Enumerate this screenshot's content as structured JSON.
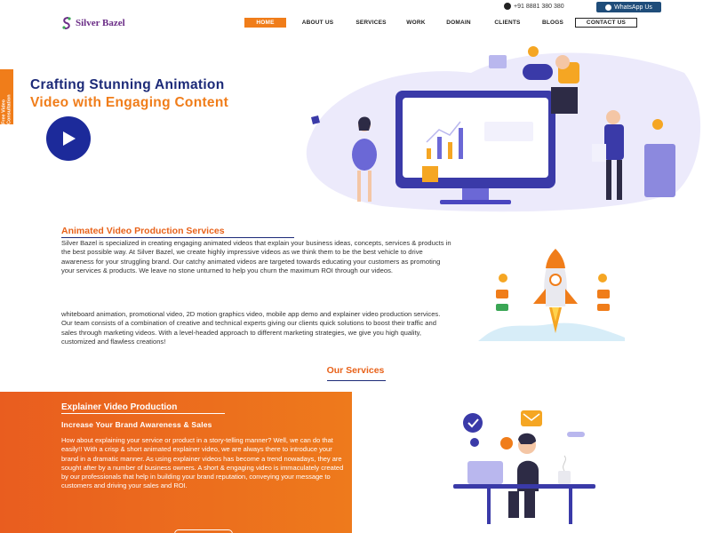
{
  "topbar": {
    "phone": "+91 8881 380 380",
    "whatsapp_label": "WhatsApp Us"
  },
  "header": {
    "logo_text": "Silver Bazel",
    "nav": [
      "HOME",
      "ABOUT US",
      "SERVICES",
      "WORK",
      "DOMAIN",
      "CLIENTS",
      "BLOGS",
      "CONTACT US"
    ]
  },
  "side_tab": {
    "label": "Free Video Consultation"
  },
  "hero": {
    "title_line1": "Crafting Stunning Animation",
    "title_line2": "Video with Engaging Content"
  },
  "about": {
    "title": "Animated Video Production Services",
    "para1": "Silver Bazel is specialized in creating engaging animated videos that explain your business ideas, concepts, services & products in the best possible way. At Silver Bazel, we create highly impressive videos as we think them to be the best vehicle to drive awareness for your struggling brand. Our catchy animated videos are targeted towards educating your customers as promoting your services & products. We leave no stone unturned to help you churn the maximum ROI through our videos.",
    "para2": "whiteboard animation, promotional video, 2D motion graphics video, mobile app demo and explainer video production services. Our team consists of a combination of creative and technical experts giving our clients quick solutions to boost their traffic and sales through marketing videos. With a level-headed approach to different marketing strategies, we give you high quality, customized and flawless creations!"
  },
  "services": {
    "heading": "Our Services",
    "card": {
      "title": "Explainer Video Production",
      "subtitle": "Increase Your Brand Awareness & Sales",
      "text": "How about explaining your service or product in a story-telling manner? Well, we can do that easily!! With a crisp & short animated explainer video, we are always there to introduce your brand in a dramatic manner. As using explainer videos has become a trend nowadays, they are sought after by a number of business owners. A short & engaging video is immaculately created by our professionals that help in building your brand reputation, conveying your message to customers and driving your sales and ROI."
    }
  },
  "colors": {
    "brand_orange": "#f07d1a",
    "brand_navy": "#1c2a78",
    "whatsapp_bar": "#1f4d7a"
  }
}
